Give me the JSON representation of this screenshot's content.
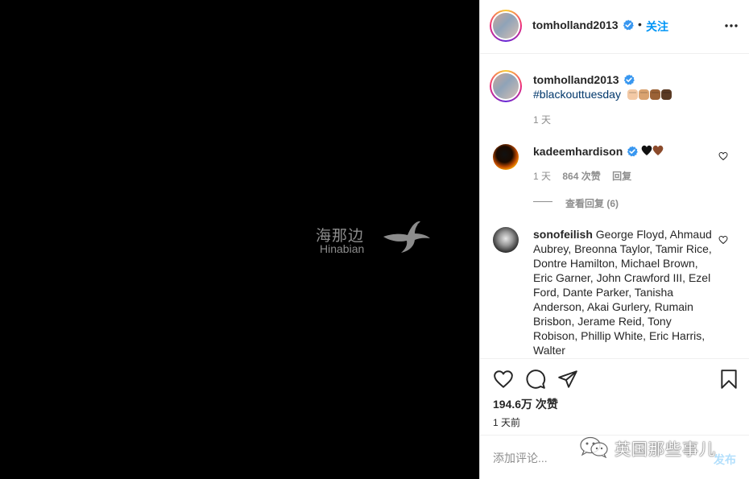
{
  "watermark": {
    "chinese": "海那边",
    "latin": "Hinabian"
  },
  "post": {
    "username": "tomholland2013",
    "dot": "•",
    "follow_label": "关注",
    "more_icon": "more-horizontal-icon",
    "caption": {
      "username": "tomholland2013",
      "hashtag": "#blackouttuesday",
      "emojis": [
        "raised-fist-light",
        "raised-fist-medium",
        "raised-fist-dark",
        "raised-fist-darkest"
      ],
      "time": "1 天"
    },
    "comments": [
      {
        "username": "kadeemhardison",
        "emojis": [
          "black-heart",
          "brown-heart"
        ],
        "time": "1 天",
        "likes": "864 次赞",
        "reply_label": "回复",
        "view_replies": "查看回复 (6)"
      },
      {
        "username": "sonofeilish",
        "text": "George Floyd, Ahmaud Aubrey, Breonna Taylor, Tamir Rice, Dontre Hamilton, Michael Brown, Eric Garner, John Crawford III, Ezel Ford, Dante Parker, Tanisha Anderson, Akai Gurlery, Rumain Brisbon, Jerame Reid, Tony Robison, Phillip White, Eric Harris, Walter"
      }
    ],
    "likes_count": "194.6万 次赞",
    "time_ago": "1 天前",
    "comment_placeholder": "添加评论...",
    "post_label": "发布"
  },
  "wechat_watermark": {
    "text": "英国那些事儿"
  },
  "colors": {
    "accent": "#0095f6",
    "hashtag": "#00376b",
    "muted": "#8e8e8e",
    "media_bg": "#000000",
    "post_disabled": "#b2dffc"
  }
}
